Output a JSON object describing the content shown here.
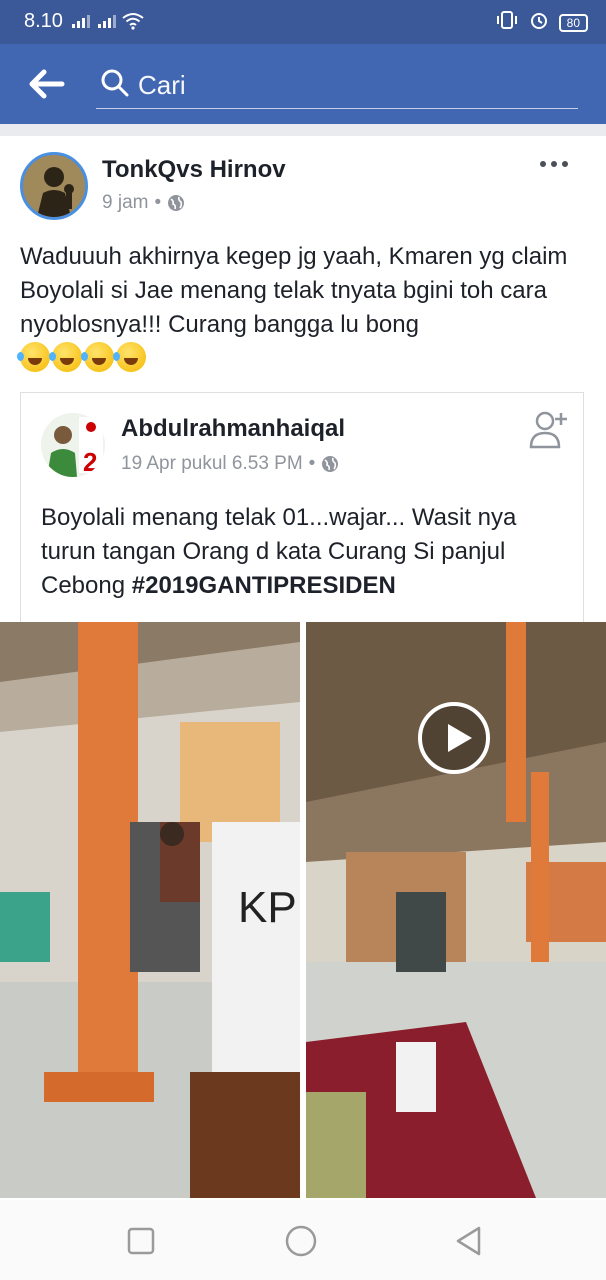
{
  "status_bar": {
    "time": "8.10",
    "battery": "80"
  },
  "search": {
    "placeholder": "Cari"
  },
  "post": {
    "author": "TonkQvs Hirnov",
    "time": "9 jam",
    "separator": "•",
    "text": "Waduuuh akhirnya kegep jg yaah, Kmaren yg claim Boyolali si Jae menang telak tnyata bgini toh cara nyoblosnya!!!  Curang bangga lu bong",
    "emoji_count": 4,
    "shared": {
      "author": "Abdulrahmanhaiqal",
      "time": "19 Apr pukul 6.53 PM",
      "separator": "•",
      "text": "Boyolali menang telak 01...wajar... Wasit nya turun tangan Orang d kata Curang Si panjul Cebong ",
      "hashtag": "#2019GANTIPRESIDEN",
      "avatar_badge": "2"
    },
    "video": {
      "box_label": "KPU"
    }
  },
  "icons": [
    "back-arrow-icon",
    "search-icon",
    "globe-icon",
    "more-icon",
    "add-friend-icon",
    "play-icon",
    "recent-apps-icon",
    "home-icon",
    "nav-back-icon"
  ]
}
